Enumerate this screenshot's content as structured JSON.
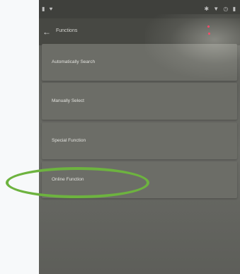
{
  "status_bar": {
    "left_icons": "▮ ♥",
    "right_icons": "✱ ▼ ◷ ▮"
  },
  "app_bar": {
    "back_icon": "arrow-left-icon",
    "title": "Functions"
  },
  "functions": {
    "items": [
      {
        "label": "Automatically Search"
      },
      {
        "label": "Manually Select"
      },
      {
        "label": "Special Function"
      },
      {
        "label": "Online Function"
      }
    ]
  },
  "annotation": {
    "color": "#6db33f",
    "highlighted_item": "Online Function"
  },
  "colors": {
    "page_background": "#f7f9fa",
    "app_bar": "#474843",
    "list_item": "#6c6d67",
    "text": "#e2e2de"
  }
}
